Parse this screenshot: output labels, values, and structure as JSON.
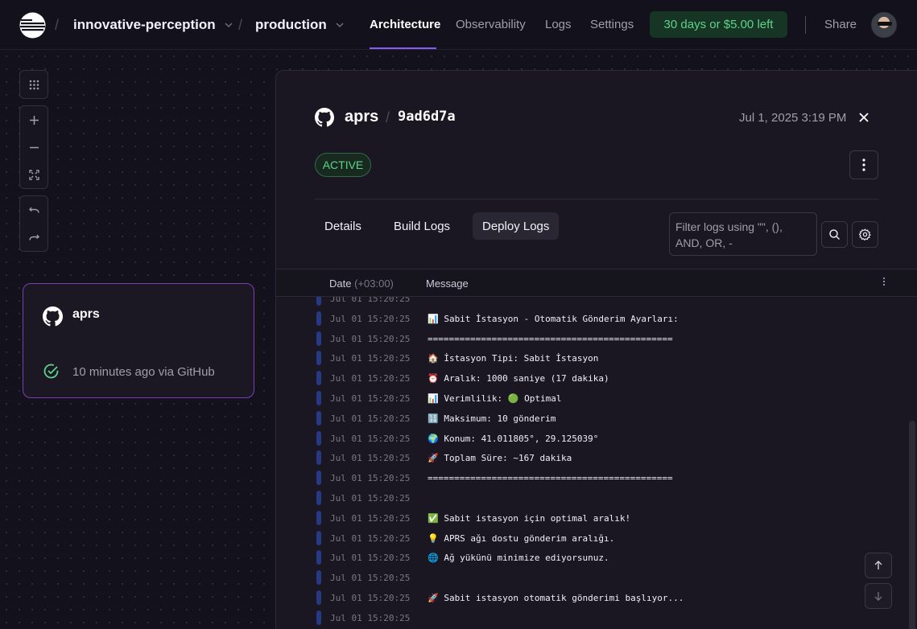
{
  "topbar": {
    "project": "innovative-perception",
    "environment": "production",
    "tabs": [
      {
        "label": "Architecture"
      },
      {
        "label": "Observability"
      },
      {
        "label": "Logs"
      },
      {
        "label": "Settings"
      }
    ],
    "trial_badge": "30 days or $5.00 left",
    "share_label": "Share"
  },
  "service_card": {
    "name": "aprs",
    "status": "10 minutes ago via GitHub"
  },
  "panel": {
    "service_name": "aprs",
    "commit": "9ad6d7a",
    "date": "Jul 1, 2025 3:19 PM",
    "status_badge": "ACTIVE",
    "tabs": [
      {
        "label": "Details"
      },
      {
        "label": "Build Logs"
      },
      {
        "label": "Deploy Logs"
      }
    ],
    "filter_placeholder": "Filter logs using \"\", (), AND, OR, -",
    "log_header": {
      "date_label": "Date",
      "timezone": "(+03:00)",
      "message_label": "Message"
    },
    "logs": [
      {
        "ts": "Jul 01 15:20:25",
        "msg": ""
      },
      {
        "ts": "Jul 01 15:20:25",
        "msg": "📊 Sabit İstasyon - Otomatik Gönderim Ayarları:"
      },
      {
        "ts": "Jul 01 15:20:25",
        "msg": "=============================================="
      },
      {
        "ts": "Jul 01 15:20:25",
        "msg": "🏠 İstasyon Tipi: Sabit İstasyon"
      },
      {
        "ts": "Jul 01 15:20:25",
        "msg": "⏰ Aralık: 1000 saniye (17 dakika)"
      },
      {
        "ts": "Jul 01 15:20:25",
        "msg": "📊 Verimlilik: 🟢 Optimal"
      },
      {
        "ts": "Jul 01 15:20:25",
        "msg": "🔢 Maksimum: 10 gönderim"
      },
      {
        "ts": "Jul 01 15:20:25",
        "msg": "🌍 Konum: 41.011805°, 29.125039°"
      },
      {
        "ts": "Jul 01 15:20:25",
        "msg": "🚀 Toplam Süre: ~167 dakika"
      },
      {
        "ts": "Jul 01 15:20:25",
        "msg": "=============================================="
      },
      {
        "ts": "Jul 01 15:20:25",
        "msg": ""
      },
      {
        "ts": "Jul 01 15:20:25",
        "msg": "✅ Sabit istasyon için optimal aralık!"
      },
      {
        "ts": "Jul 01 15:20:25",
        "msg": "💡 APRS ağı dostu gönderim aralığı."
      },
      {
        "ts": "Jul 01 15:20:25",
        "msg": "🌐 Ağ yükünü minimize ediyorsunuz."
      },
      {
        "ts": "Jul 01 15:20:25",
        "msg": ""
      },
      {
        "ts": "Jul 01 15:20:25",
        "msg": "🚀 Sabit istasyon otomatik gönderimi başlıyor..."
      },
      {
        "ts": "Jul 01 15:20:25",
        "msg": ""
      }
    ]
  },
  "colors": {
    "accent": "#8a5cf6",
    "success": "#5ed38a",
    "background": "#13111c",
    "panel": "#1a1722",
    "log_bar": "#253a82"
  }
}
